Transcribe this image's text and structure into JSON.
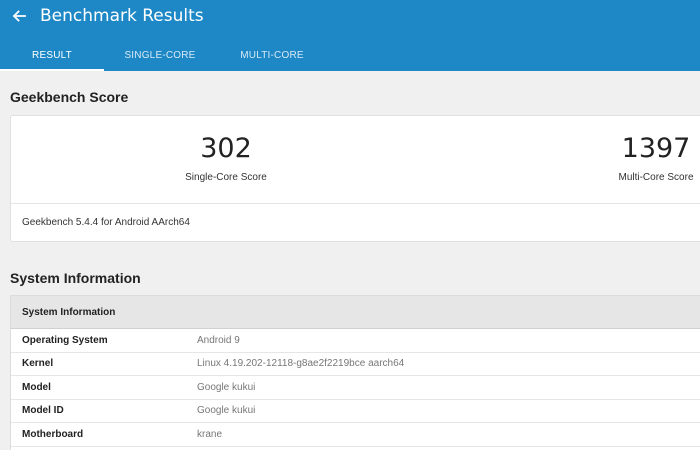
{
  "header": {
    "title": "Benchmark Results",
    "back_icon": "arrow-left-icon",
    "color": "#1e88c7"
  },
  "tabs": [
    {
      "label": "RESULT",
      "active": true
    },
    {
      "label": "SINGLE-CORE",
      "active": false
    },
    {
      "label": "MULTI-CORE",
      "active": false
    }
  ],
  "score_section": {
    "title": "Geekbench Score",
    "single_core": {
      "value": "302",
      "label": "Single-Core Score"
    },
    "multi_core": {
      "value": "1397",
      "label": "Multi-Core Score"
    },
    "version": "Geekbench 5.4.4 for Android AArch64"
  },
  "system_section": {
    "title": "System Information",
    "table_header": "System Information",
    "rows": [
      {
        "key": "Operating System",
        "value": "Android 9"
      },
      {
        "key": "Kernel",
        "value": "Linux 4.19.202-12118-g8ae2f2219bce aarch64"
      },
      {
        "key": "Model",
        "value": "Google kukui"
      },
      {
        "key": "Model ID",
        "value": "Google kukui"
      },
      {
        "key": "Motherboard",
        "value": "krane"
      }
    ]
  }
}
